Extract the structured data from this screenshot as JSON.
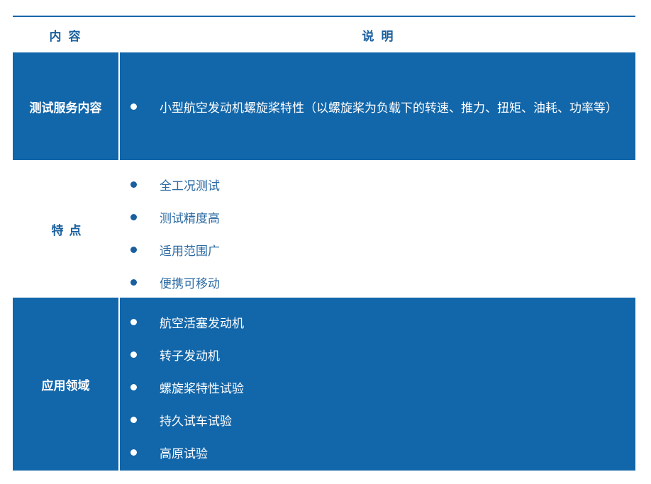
{
  "header": {
    "col_left": "内容",
    "col_right": "说明"
  },
  "rows": [
    {
      "label": "测试服务内容",
      "items": [
        "小型航空发动机螺旋桨特性（以螺旋桨为负载下的转速、推力、扭矩、油耗、功率等）"
      ]
    },
    {
      "label": "特点",
      "items": [
        "全工况测试",
        "测试精度高",
        "适用范围广",
        "便携可移动"
      ]
    },
    {
      "label": "应用领域",
      "items": [
        "航空活塞发动机",
        "转子发动机",
        "螺旋桨特性试验",
        "持久试车试验",
        "高原试验"
      ]
    }
  ],
  "colors": {
    "accent_blue": "#1266aa",
    "header_text": "#1a5f9e",
    "background": "#ffffff"
  }
}
